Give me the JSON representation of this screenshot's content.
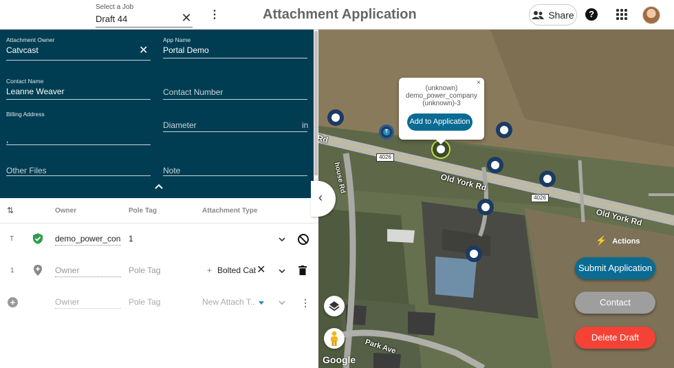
{
  "header": {
    "job_label": "Select a Job",
    "job_value": "Draft 44",
    "title": "Attachment Application",
    "share_label": "Share",
    "help_glyph": "?"
  },
  "form": {
    "attachment_owner": {
      "label": "Attachment Owner",
      "value": "Catvcast"
    },
    "app_name": {
      "label": "App Name",
      "value": "Portal Demo"
    },
    "contact_name": {
      "label": "Contact Name",
      "value": "Leanne Weaver"
    },
    "contact_number": {
      "placeholder": "Contact Number"
    },
    "billing_address": {
      "label": "Billing Address",
      "value": ","
    },
    "diameter": {
      "placeholder": "Diameter",
      "unit": "in"
    },
    "other_files": {
      "placeholder": "Other Files"
    },
    "note": {
      "placeholder": "Note"
    }
  },
  "table": {
    "headers": {
      "owner": "Owner",
      "pole_tag": "Pole Tag",
      "attachment_type": "Attachment Type"
    },
    "rows": [
      {
        "index": "T",
        "owner": "demo_power_con",
        "pole_tag": "1",
        "attachment_type": ""
      },
      {
        "index": "1",
        "owner": "Owner",
        "pole_tag": "Pole Tag",
        "attachment_type": "Bolted Cab"
      },
      {
        "index": "",
        "owner": "Owner",
        "pole_tag": "Pole Tag",
        "attachment_type": "New Attach T..."
      }
    ]
  },
  "map": {
    "popup": {
      "line1": "(unknown)",
      "line2": "demo_power_company",
      "line3": "(unknown)-3",
      "button": "Add to Application",
      "close": "×"
    },
    "roads": {
      "old_york_1": "Old York Rd",
      "old_york_2": "Old York Rd",
      "park_ave": "Park Ave",
      "rd_left": "Rd",
      "house_rd": "house Rd",
      "route_1": "4026",
      "route_2": "4026"
    },
    "google": "Google",
    "marker_letter": "T"
  },
  "actions": {
    "label": "Actions",
    "submit": "Submit Application",
    "contact": "Contact",
    "delete": "Delete Draft"
  },
  "colors": {
    "panel": "#003d52",
    "submit": "#0a6b93",
    "contact": "#9e9e9e",
    "delete": "#f44336",
    "pin": "#1b3b63",
    "check": "#2e9e4f"
  }
}
